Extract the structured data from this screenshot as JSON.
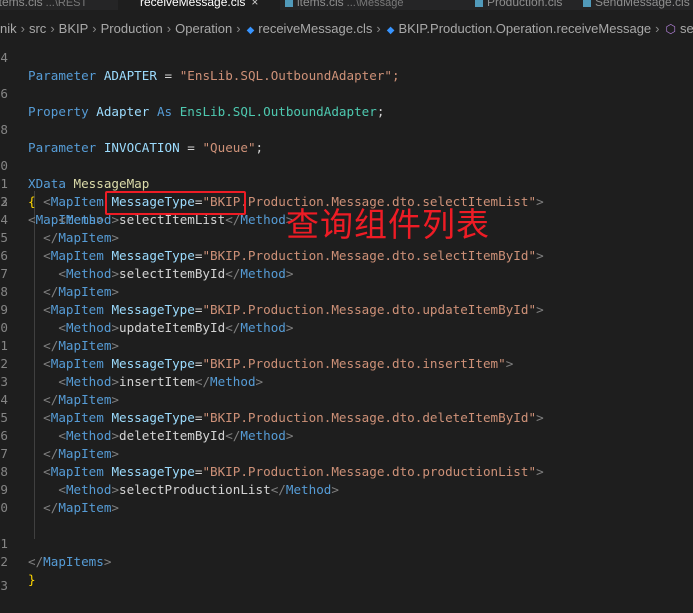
{
  "tabs": [
    {
      "label": "items.cls",
      "description": "...\\REST",
      "active": false
    },
    {
      "label": "receiveMessage.cls",
      "description": "",
      "active": true,
      "close": "×"
    },
    {
      "label": "items.cls",
      "description": "...\\Message",
      "active": false
    },
    {
      "label": "Production.cls",
      "description": "",
      "active": false
    },
    {
      "label": "SendMessage.cls",
      "description": "",
      "active": false
    }
  ],
  "breadcrumb": [
    "nik",
    "src",
    "BKIP",
    "Production",
    "Operation",
    "receiveMessage.cls",
    "BKIP.Production.Operation.receiveMessage",
    "selec"
  ],
  "code": {
    "line1": {
      "ln": "4",
      "kw": "Parameter",
      "name": "ADAPTER",
      "eq": "=",
      "val": "\"EnsLib.SQL.OutboundAdapter\";"
    },
    "line3": {
      "ln": "6",
      "kw": "Property",
      "name": "Adapter",
      "as": "As",
      "type": "EnsLib.SQL.OutboundAdapter",
      "semi": ";"
    },
    "line5": {
      "ln": "8",
      "kw": "Parameter",
      "name": "INVOCATION",
      "eq": "=",
      "val": "\"Queue\"",
      "semi": ";"
    },
    "line7": {
      "ln": "0",
      "kw": "XData",
      "name": "MessageMap"
    },
    "line8": {
      "ln": "1",
      "brace": "{"
    },
    "open_mapitems": {
      "ln": "2",
      "tag": "MapItems"
    },
    "map_items": [
      {
        "ln_item": "3",
        "ln_method": "4",
        "ln_close": "5",
        "attr": "MessageType",
        "value": "\"BKIP.Production.Message.dto.selectItemList\"",
        "method": "selectItemList"
      },
      {
        "ln_item": "6",
        "ln_method": "7",
        "ln_close": "8",
        "attr": "MessageType",
        "value": "\"BKIP.Production.Message.dto.selectItemById\"",
        "method": "selectItemById"
      },
      {
        "ln_item": "9",
        "ln_method": "0",
        "ln_close": "1",
        "attr": "MessageType",
        "value": "\"BKIP.Production.Message.dto.updateItemById\"",
        "method": "updateItemById"
      },
      {
        "ln_item": "2",
        "ln_method": "3",
        "ln_close": "4",
        "attr": "MessageType",
        "value": "\"BKIP.Production.Message.dto.insertItem\"",
        "method": "insertItem"
      },
      {
        "ln_item": "5",
        "ln_method": "6",
        "ln_close": "7",
        "attr": "MessageType",
        "value": "\"BKIP.Production.Message.dto.deleteItemById\"",
        "method": "deleteItemById"
      },
      {
        "ln_item": "8",
        "ln_method": "9",
        "ln_close": "0",
        "attr": "MessageType",
        "value": "\"BKIP.Production.Message.dto.productionList\"",
        "method": "selectProductionList"
      }
    ],
    "tag_mapitem": "MapItem",
    "tag_method": "Method",
    "close_mapitems": {
      "ln": "1",
      "tag": "MapItems"
    },
    "close_brace": {
      "ln": "2",
      "brace": "}"
    },
    "last_ln": "3"
  },
  "annotation": "查询组件列表",
  "colors": {
    "background": "#1e1e1e",
    "keyword": "#569cd6",
    "string": "#ce9178",
    "annotation": "#ee1c25"
  }
}
